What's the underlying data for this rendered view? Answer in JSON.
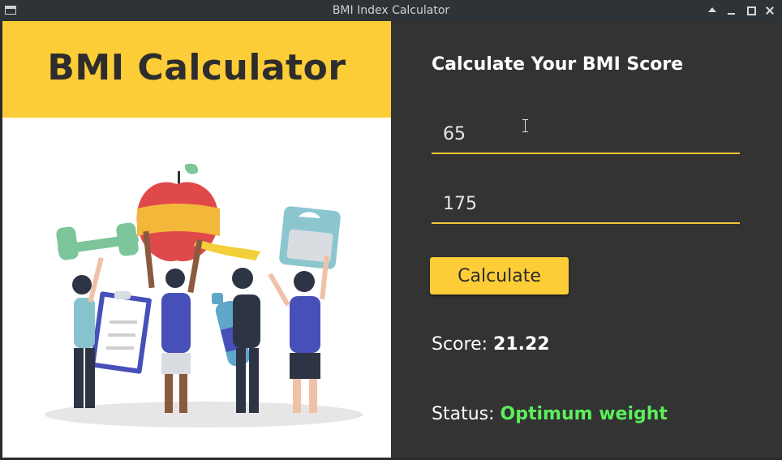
{
  "window": {
    "title": "BMI Index Calculator",
    "controls": [
      "keep-above-icon",
      "minimize-icon",
      "maximize-icon",
      "close-icon"
    ]
  },
  "banner": {
    "title": "BMI Calculator",
    "background": "#fdcd37"
  },
  "illustration": {
    "subject": "people holding apple with tape measure, dumbbell, clipboard, water bottle and weighing scale"
  },
  "form": {
    "heading": "Calculate Your BMI Score",
    "weight_value": "65",
    "height_value": "175",
    "calculate_label": "Calculate",
    "accent_color": "#fdcd37"
  },
  "result": {
    "score_label": "Score:",
    "score_value": "21.22",
    "status_label": "Status:",
    "status_value": "Optimum weight",
    "status_color": "#5bef5b"
  }
}
